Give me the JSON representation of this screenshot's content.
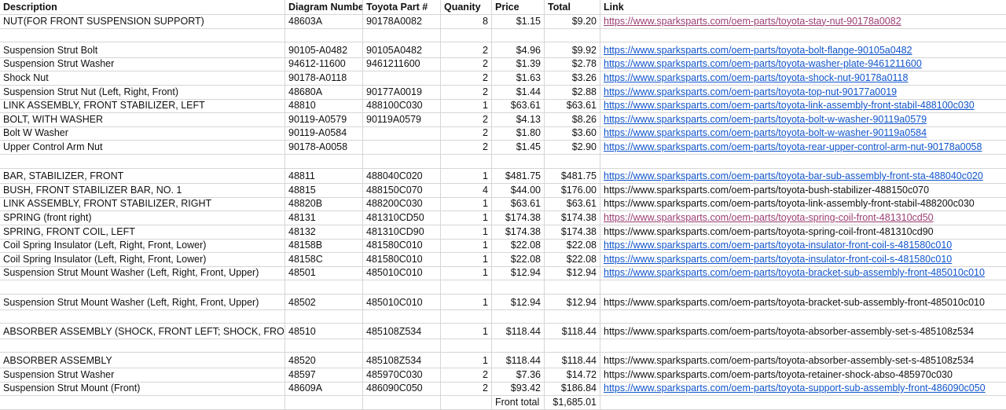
{
  "sheet": {
    "headers": {
      "description": "Description",
      "diagram": "Diagram Number",
      "part": "Toyota Part #",
      "qty": "Quanity",
      "price": "Price",
      "total": "Total",
      "link": "Link"
    },
    "rows": [
      {
        "d": "NUT(FOR FRONT SUSPENSION SUPPORT)",
        "g": "48603A",
        "p": "90178A0082",
        "q": "8",
        "pr": "$1.15",
        "t": "$9.20",
        "l": "https://www.sparksparts.com/oem-parts/toyota-stay-nut-90178a0082",
        "lc": "visited"
      },
      {
        "d": "",
        "g": "",
        "p": "",
        "q": "",
        "pr": "",
        "t": "",
        "l": "",
        "lc": "plain"
      },
      {
        "d": "Suspension Strut Bolt",
        "g": "90105-A0482",
        "p": " 90105A0482",
        "q": "2",
        "pr": "$4.96",
        "t": "$9.92",
        "l": "https://www.sparksparts.com/oem-parts/toyota-bolt-flange-90105a0482",
        "lc": "blue"
      },
      {
        "d": "Suspension Strut Washer",
        "g": "94612-11600",
        "p": "9461211600",
        "q": "2",
        "pr": "$1.39",
        "t": "$2.78",
        "l": "https://www.sparksparts.com/oem-parts/toyota-washer-plate-9461211600",
        "lc": "blue"
      },
      {
        "d": "Shock Nut",
        "g": "90178-A0118",
        "p": "",
        "q": "2",
        "pr": "$1.63",
        "t": "$3.26",
        "l": "https://www.sparksparts.com/oem-parts/toyota-shock-nut-90178a0118",
        "lc": "blue"
      },
      {
        "d": "Suspension Strut Nut (Left, Right, Front)",
        "g": "48680A",
        "p": "90177A0019",
        "q": "2",
        "pr": "$1.44",
        "t": "$2.88",
        "l": "https://www.sparksparts.com/oem-parts/toyota-top-nut-90177a0019",
        "lc": "blue"
      },
      {
        "d": "LINK ASSEMBLY, FRONT STABILIZER, LEFT",
        "g": "48810",
        "p": "488100C030",
        "q": "1",
        "pr": "$63.61",
        "t": "$63.61",
        "l": "https://www.sparksparts.com/oem-parts/toyota-link-assembly-front-stabil-488100c030",
        "lc": "blue"
      },
      {
        "d": "BOLT, WITH WASHER",
        "g": "90119-A0579",
        "p": "90119A0579",
        "q": "2",
        "pr": "$4.13",
        "t": "$8.26",
        "l": "https://www.sparksparts.com/oem-parts/toyota-bolt-w-washer-90119a0579",
        "lc": "blue"
      },
      {
        "d": "Bolt W Washer",
        "g": "90119-A0584",
        "p": "",
        "q": "2",
        "pr": "$1.80",
        "t": "$3.60",
        "l": "https://www.sparksparts.com/oem-parts/toyota-bolt-w-washer-90119a0584",
        "lc": "blue"
      },
      {
        "d": "Upper Control Arm Nut",
        "g": "90178-A0058",
        "p": "",
        "q": "2",
        "pr": "$1.45",
        "t": "$2.90",
        "l": "https://www.sparksparts.com/oem-parts/toyota-rear-upper-control-arm-nut-90178a0058",
        "lc": "blue"
      },
      {
        "d": "",
        "g": "",
        "p": "",
        "q": "",
        "pr": "",
        "t": "",
        "l": "",
        "lc": "plain"
      },
      {
        "d": "BAR, STABILIZER, FRONT",
        "g": "48811",
        "p": "488040C020",
        "q": "1",
        "pr": "$481.75",
        "t": "$481.75",
        "l": "https://www.sparksparts.com/oem-parts/toyota-bar-sub-assembly-front-sta-488040c020",
        "lc": "blue"
      },
      {
        "d": "BUSH, FRONT STABILIZER BAR, NO. 1",
        "g": "48815",
        "p": "488150C070",
        "q": "4",
        "pr": "$44.00",
        "t": "$176.00",
        "l": "https://www.sparksparts.com/oem-parts/toyota-bush-stabilizer-488150c070",
        "lc": "plain"
      },
      {
        "d": "LINK ASSEMBLY, FRONT STABILIZER, RIGHT",
        "g": "48820B",
        "p": "488200C030",
        "q": "1",
        "pr": "$63.61",
        "t": "$63.61",
        "l": "https://www.sparksparts.com/oem-parts/toyota-link-assembly-front-stabil-488200c030",
        "lc": "plain"
      },
      {
        "d": "SPRING (front right)",
        "g": "48131",
        "p": "481310CD50",
        "q": "1",
        "pr": "$174.38",
        "t": "$174.38",
        "l": "https://www.sparksparts.com/oem-parts/toyota-spring-coil-front-481310cd50",
        "lc": "visited"
      },
      {
        "d": "SPRING, FRONT COIL, LEFT",
        "g": "48132",
        "p": "481310CD90",
        "q": "1",
        "pr": "$174.38",
        "t": "$174.38",
        "l": "https://www.sparksparts.com/oem-parts/toyota-spring-coil-front-481310cd90",
        "lc": "plain"
      },
      {
        "d": "Coil Spring Insulator (Left, Right, Front, Lower)",
        "g": "48158B",
        "p": "481580C010",
        "q": "1",
        "pr": "$22.08",
        "t": "$22.08",
        "l": "https://www.sparksparts.com/oem-parts/toyota-insulator-front-coil-s-481580c010",
        "lc": "blue"
      },
      {
        "d": "Coil Spring Insulator (Left, Right, Front, Lower)",
        "g": "48158C",
        "p": "481580C010",
        "q": "1",
        "pr": "$22.08",
        "t": "$22.08",
        "l": "https://www.sparksparts.com/oem-parts/toyota-insulator-front-coil-s-481580c010",
        "lc": "blue"
      },
      {
        "d": "Suspension Strut Mount Washer (Left, Right, Front, Upper)",
        "g": "48501",
        "p": "485010C010",
        "q": "1",
        "pr": "$12.94",
        "t": "$12.94",
        "l": "https://www.sparksparts.com/oem-parts/toyota-bracket-sub-assembly-front-485010c010",
        "lc": "blue"
      },
      {
        "d": "",
        "g": "",
        "p": "",
        "q": "",
        "pr": "",
        "t": "",
        "l": "",
        "lc": "plain"
      },
      {
        "d": "Suspension Strut Mount Washer (Left, Right, Front, Upper)",
        "g": "48502",
        "p": "485010C010",
        "q": "1",
        "pr": "$12.94",
        "t": "$12.94",
        "l": "https://www.sparksparts.com/oem-parts/toyota-bracket-sub-assembly-front-485010c010",
        "lc": "plain"
      },
      {
        "d": "",
        "g": "",
        "p": "",
        "q": "",
        "pr": "",
        "t": "",
        "l": "",
        "lc": "plain"
      },
      {
        "d": "ABSORBER ASSEMBLY (SHOCK, FRONT LEFT; SHOCK, FRONT RIGHT",
        "g": "48510",
        "p": "485108Z534",
        "q": "1",
        "pr": "$118.44",
        "t": "$118.44",
        "l": "https://www.sparksparts.com/oem-parts/toyota-absorber-assembly-set-s-485108z534",
        "lc": "plain"
      },
      {
        "d": "",
        "g": "",
        "p": "",
        "q": "",
        "pr": "",
        "t": "",
        "l": "",
        "lc": "plain"
      },
      {
        "d": "ABSORBER ASSEMBLY",
        "g": "48520",
        "p": "485108Z534",
        "q": "1",
        "pr": "$118.44",
        "t": "$118.44",
        "l": "https://www.sparksparts.com/oem-parts/toyota-absorber-assembly-set-s-485108z534",
        "lc": "plain"
      },
      {
        "d": "Suspension Strut Washer",
        "g": "48597",
        "p": "485970C030",
        "q": "2",
        "pr": "$7.36",
        "t": "$14.72",
        "l": "https://www.sparksparts.com/oem-parts/toyota-retainer-shock-abso-485970c030",
        "lc": "plain"
      },
      {
        "d": "Suspension Strut Mount (Front)",
        "g": "48609A",
        "p": "486090C050",
        "q": "2",
        "pr": "$93.42",
        "t": "$186.84",
        "l": "https://www.sparksparts.com/oem-parts/toyota-support-sub-assembly-front-486090c050",
        "lc": "blue"
      }
    ],
    "footer": {
      "label": "Front total",
      "value": "$1,685.01"
    }
  }
}
